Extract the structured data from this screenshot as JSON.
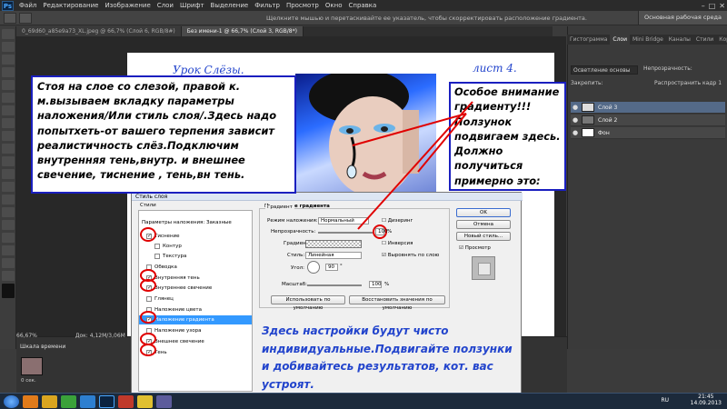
{
  "app": {
    "logo": "Ps"
  },
  "menu": [
    "Файл",
    "Редактирование",
    "Изображение",
    "Слои",
    "Шрифт",
    "Выделение",
    "Фильтр",
    "Просмотр",
    "Окно",
    "Справка"
  ],
  "options_bar": {
    "hint": "Щелкните мышью и перетаскивайте ее указатель, чтобы скорректировать расположение градиента.",
    "search_3d": "Основная рабочая среда"
  },
  "tabs": [
    {
      "label": "0_69d60_a85e9a73_XL.jpeg @ 66,7% (Слой 6, RGB/8#)",
      "active": false
    },
    {
      "label": "Без имени-1 @ 66,7% (Слой 3, RGB/8*)",
      "active": true
    }
  ],
  "canvas": {
    "title_left": "Урок Слёзы.",
    "title_right": "лист 4."
  },
  "notes": {
    "left": "Стоя на слое со слезой, правой к. м.вызываем вкладку параметры наложения/Или стиль слоя/.Здесь надо попытхеть-от вашего терпения зависит реалистичность слёз.Подключим внутренняя тень,внутр. и внешнее свечение, тиснение , тень,вн тень.",
    "right": "Особое внимание градиенту!!! Ползунок подвигаем здесь. Должно получиться примерно это:",
    "bottom": "Здесь настройки будут чисто индивидуальные.Подвигайте ползунки и добивайтесь результатов, кот. вас устроят."
  },
  "right_panel": {
    "tabs": [
      "Гистограмма",
      "Слои",
      "Mini Bridge",
      "Каналы",
      "Стили",
      "Коррекция"
    ],
    "blend_mode": "Осветление основы",
    "opacity_label": "Непрозрачность:",
    "lock_label": "Закрепить:",
    "fill_label": "Распространить кадр 1",
    "layers": [
      {
        "name": "Слой 3",
        "active": true
      },
      {
        "name": "Слой 2",
        "active": false
      },
      {
        "name": "Фон",
        "active": false
      }
    ]
  },
  "status": {
    "zoom": "66,67%",
    "doc": "Док: 4,12М/3,06М"
  },
  "timeline": {
    "title": "Шкала времени",
    "frame_time": "0 сек."
  },
  "dialog": {
    "title": "Стиль слоя",
    "styles_header": "Стили",
    "blend_options": "Параметры наложения: Заказные",
    "styles": [
      {
        "label": "Тиснение",
        "checked": true,
        "circled": true,
        "indent": false
      },
      {
        "label": "Контур",
        "checked": false,
        "circled": false,
        "indent": true
      },
      {
        "label": "Текстура",
        "checked": false,
        "circled": false,
        "indent": true
      },
      {
        "label": "Обводка",
        "checked": false,
        "circled": false,
        "indent": false
      },
      {
        "label": "Внутренняя тень",
        "checked": true,
        "circled": true,
        "indent": false
      },
      {
        "label": "Внутреннее свечение",
        "checked": true,
        "circled": true,
        "indent": false
      },
      {
        "label": "Глянец",
        "checked": false,
        "circled": false,
        "indent": false
      },
      {
        "label": "Наложение цвета",
        "checked": false,
        "circled": false,
        "indent": false
      },
      {
        "label": "Наложение градиента",
        "checked": true,
        "circled": true,
        "indent": false,
        "active": true
      },
      {
        "label": "Наложение узора",
        "checked": false,
        "circled": false,
        "indent": false
      },
      {
        "label": "Внешнее свечение",
        "checked": true,
        "circled": true,
        "indent": false
      },
      {
        "label": "Тень",
        "checked": true,
        "circled": true,
        "indent": false
      }
    ],
    "section_title": "Наложение градиента",
    "group_title": "Градиент",
    "blend_mode_label": "Режим наложения:",
    "blend_mode_value": "Нормальный",
    "dither_label": "Дизеринг",
    "opacity_label": "Непрозрачность:",
    "opacity_value": "100",
    "gradient_label": "Градиент:",
    "reverse_label": "Инверсия",
    "style_label": "Стиль:",
    "style_value": "Линейная",
    "align_label": "Выровнять по слою",
    "angle_label": "Угол:",
    "angle_value": "90",
    "scale_label": "Масштаб:",
    "scale_value": "100",
    "pct": "%",
    "deg": "°",
    "default_btn": "Использовать по умолчанию",
    "reset_btn": "Восстановить значения по умолчанию",
    "ok": "OK",
    "cancel": "Отмена",
    "new_style": "Новый стиль...",
    "preview": "Просмотр"
  },
  "taskbar": {
    "lang": "RU",
    "time": "21:45",
    "date": "14.09.2013"
  }
}
